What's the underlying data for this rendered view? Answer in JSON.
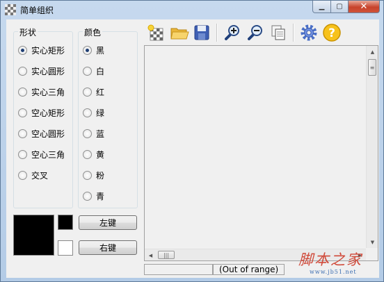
{
  "window": {
    "title": "简单组织"
  },
  "shape_group": {
    "title": "形状",
    "options": [
      "实心矩形",
      "实心圆形",
      "实心三角",
      "空心矩形",
      "空心圆形",
      "空心三角",
      "交叉"
    ],
    "selected": "实心矩形"
  },
  "color_group": {
    "title": "颜色",
    "options": [
      "黑",
      "白",
      "红",
      "绿",
      "蓝",
      "黄",
      "粉",
      "青"
    ],
    "selected": "黑"
  },
  "colors": {
    "preview": "#000000",
    "left_swatch": "#000000",
    "right_swatch": "#ffffff"
  },
  "buttons": {
    "left": "左键",
    "right": "右键"
  },
  "toolbar": [
    "new-icon",
    "open-folder-icon",
    "save-icon",
    "zoom-in-icon",
    "zoom-out-icon",
    "copy-pages-icon",
    "settings-gear-icon",
    "help-icon"
  ],
  "status": {
    "left": "",
    "right": "(Out of range)"
  },
  "watermark": {
    "main": "脚本之家",
    "sub": "www.jb51.net"
  }
}
